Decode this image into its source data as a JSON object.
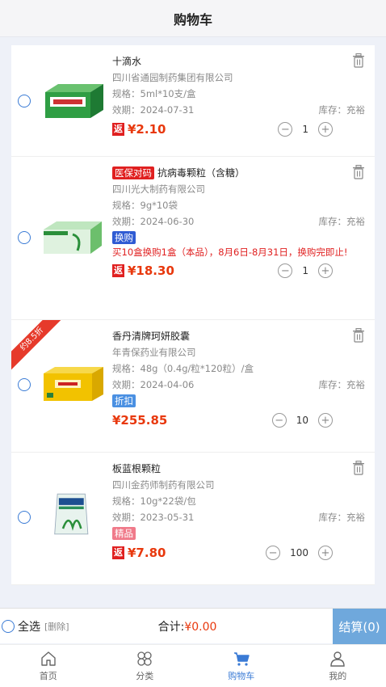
{
  "header": {
    "title": "购物车"
  },
  "items": [
    {
      "name": "十滴水",
      "manufacturer": "四川省通园制药集团有限公司",
      "spec": "规格：5ml*10支/盒",
      "expiry": "效期：2024-07-31",
      "stock": "库存：充裕",
      "return_tag": "返",
      "price": "¥2.10",
      "qty": "1"
    },
    {
      "insurance_tag": "医保对码",
      "name": "抗病毒颗粒（含糖）",
      "manufacturer": "四川光大制药有限公司",
      "spec": "规格：9g*10袋",
      "expiry": "效期：2024-06-30",
      "stock": "库存：充裕",
      "badge": "换购",
      "promo": "买10盒换购1盒（本品），8月6日-8月31日，换购完即止!",
      "return_tag": "返",
      "price": "¥18.30",
      "qty": "1"
    },
    {
      "ribbon": "约8.5折",
      "name": "香丹清牌珂妍胶囊",
      "manufacturer": "年青保药业有限公司",
      "spec": "规格：48g（0.4g/粒*120粒）/盒",
      "expiry": "效期：2024-04-06",
      "stock": "库存：充裕",
      "badge": "折扣",
      "price": "¥255.85",
      "qty": "10"
    },
    {
      "name": "板蓝根颗粒",
      "manufacturer": "四川金药师制药有限公司",
      "spec": "规格：10g*22袋/包",
      "expiry": "效期：2023-05-31",
      "stock": "库存：充裕",
      "badge": "精品",
      "return_tag": "返",
      "price": "¥7.80",
      "qty": "100"
    }
  ],
  "bottom": {
    "select_all": "全选",
    "delete": "[删除]",
    "total_label": "合计:",
    "total_value": "¥0.00",
    "checkout": "结算(0)"
  },
  "tabs": [
    "首页",
    "分类",
    "购物车",
    "我的"
  ],
  "colors": {
    "accent": "#3a7bd5",
    "price": "#e8380d",
    "checkout_bg": "#6fa8dc"
  }
}
